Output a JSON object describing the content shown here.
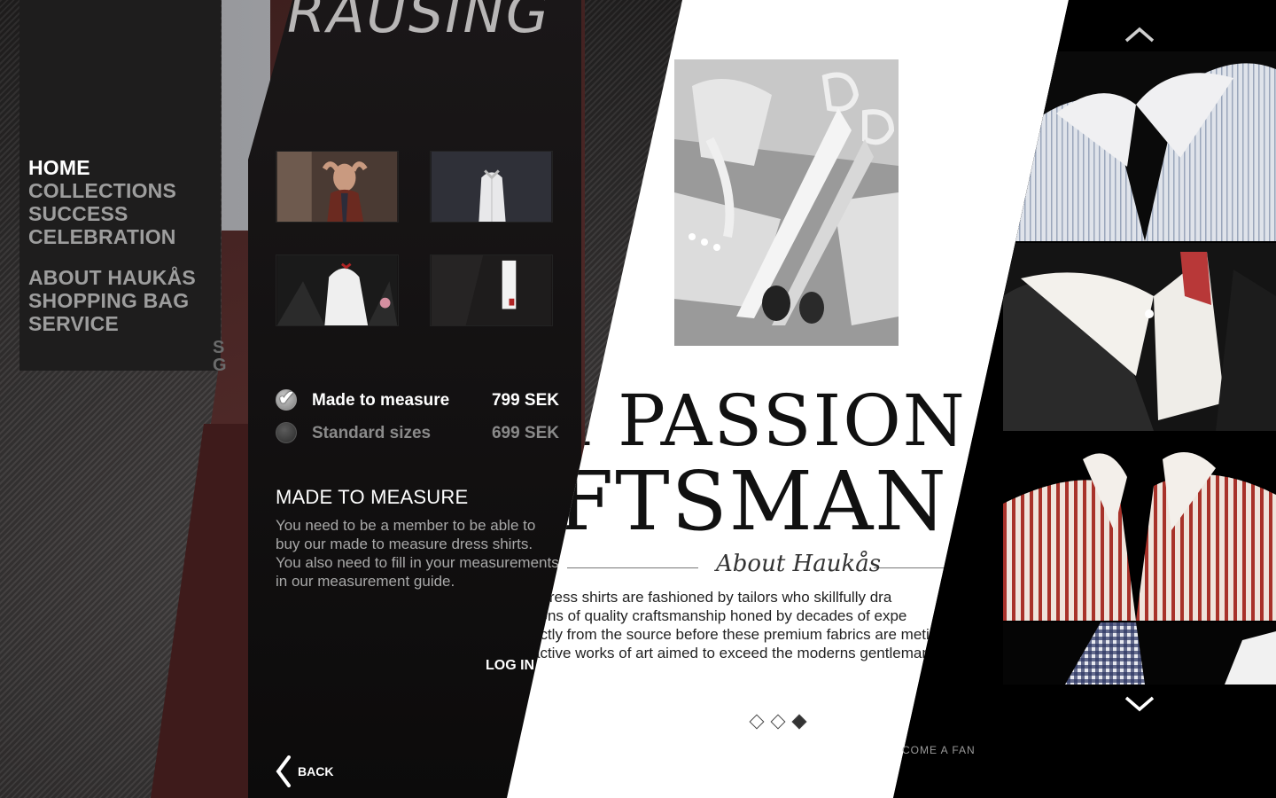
{
  "brand": {
    "title_fragment": "RAUSING"
  },
  "nav": {
    "items": [
      {
        "label": "HOME",
        "active": true
      },
      {
        "label": "COLLECTIONS",
        "active": false
      },
      {
        "label": "SUCCESS",
        "active": false
      },
      {
        "label": "CELEBRATION",
        "active": false
      }
    ],
    "secondary": [
      {
        "label": "ABOUT HAUKÅS"
      },
      {
        "label": "SHOPPING BAG"
      },
      {
        "label": "SERVICE"
      }
    ],
    "ghost_text": "S\nG"
  },
  "product": {
    "thumbnails": [
      "model-adjusting-tie",
      "white-shirt-on-stand",
      "collar-with-pocket-square",
      "jacket-and-cuff"
    ],
    "options": [
      {
        "label": "Made to measure",
        "price": "799 SEK",
        "checked": true
      },
      {
        "label": "Standard sizes",
        "price": "699 SEK",
        "checked": false
      }
    ],
    "mtm_heading": "MADE TO MEASURE",
    "mtm_text": "You need to be a member to be able to buy our made to measure dress shirts. You also need to fill in your measurements in our measurement guide.",
    "login_label": "LOG IN",
    "back_label": "BACK"
  },
  "editorial": {
    "headline_1": "a PASSION F",
    "headline_2": "AFTSMAN",
    "signature": "About Haukås",
    "body_lines": [
      "r dress shirts are fashioned by tailors who skillfully dra",
      "tions of quality craftsmanship honed by decades of expe",
      "ectly from the source before these premium fabrics are meti",
      "active works of art aimed to exceed the moderns gentleman"
    ],
    "slides_total": 3,
    "slide_active": 3
  },
  "gallery": {
    "shirts": [
      "blue-pinstripe-shirt",
      "white-shirt-red-gingham-collar",
      "red-stripe-shirt",
      "navy-gingham-shirt"
    ],
    "fan_label": "COME A FAN"
  },
  "colors": {
    "nav_active": "#ffffff",
    "nav_inactive": "#9d9d9d",
    "panel_dark": "#0e0c0c",
    "editorial_bg": "#ffffff"
  }
}
